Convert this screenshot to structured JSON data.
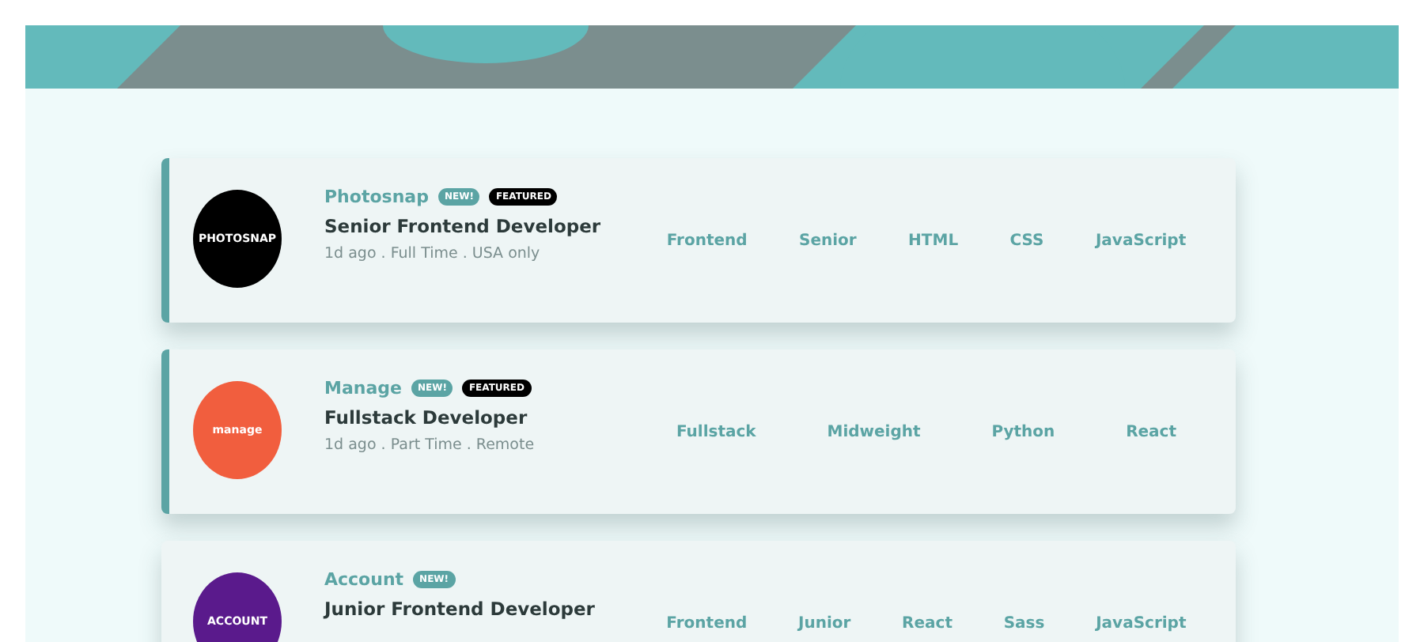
{
  "jobs": [
    {
      "company": "Photosnap",
      "logo": {
        "text": "PHOTOSNAP",
        "color": "#000000"
      },
      "badges": [
        {
          "kind": "new",
          "label": "NEW!"
        },
        {
          "kind": "featured",
          "label": "FEATURED"
        }
      ],
      "featured": true,
      "position": "Senior Frontend Developer",
      "meta": "1d ago . Full Time . USA only",
      "tags": [
        "Frontend",
        "Senior",
        "HTML",
        "CSS",
        "JavaScript"
      ]
    },
    {
      "company": "Manage",
      "logo": {
        "text": "manage",
        "color": "#f15e3e"
      },
      "badges": [
        {
          "kind": "new",
          "label": "NEW!"
        },
        {
          "kind": "featured",
          "label": "FEATURED"
        }
      ],
      "featured": true,
      "position": "Fullstack Developer",
      "meta": "1d ago . Part Time . Remote",
      "tags": [
        "Fullstack",
        "Midweight",
        "Python",
        "React"
      ]
    },
    {
      "company": "Account",
      "logo": {
        "text": "ACCOUNT",
        "color": "#5a1a8c"
      },
      "badges": [
        {
          "kind": "new",
          "label": "NEW!"
        }
      ],
      "featured": false,
      "position": "Junior Frontend Developer",
      "tags": [
        "Frontend",
        "Junior",
        "React",
        "Sass",
        "JavaScript"
      ]
    }
  ]
}
